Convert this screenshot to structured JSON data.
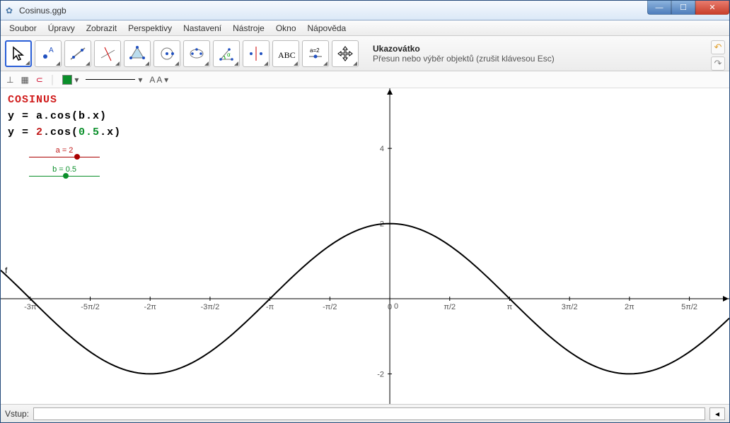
{
  "window": {
    "title": "Cosinus.ggb",
    "app_icon": "✿"
  },
  "winbuttons": {
    "min": "—",
    "max": "☐",
    "close": "✕"
  },
  "menu": [
    "Soubor",
    "Úpravy",
    "Zobrazit",
    "Perspektivy",
    "Nastavení",
    "Nástroje",
    "Okno",
    "Nápověda"
  ],
  "toolbar": {
    "selected_name": "Ukazovátko",
    "selected_desc": "Přesun nebo výběr objektů (zrušit klávesou Esc)",
    "back_icon": "↶",
    "fwd_icon": "↷"
  },
  "stylebar": {
    "axes": "⊥",
    "grid": "▦",
    "magnet": "⊂",
    "sep": "│",
    "fontsel": "A A ▾"
  },
  "overlay": {
    "title": "COSINUS",
    "eq_general": "y = a.cos(b.x)",
    "eq_specific_pre": "y = ",
    "eq_a": "2",
    "eq_mid": ".cos(",
    "eq_b": "0.5",
    "eq_post": ".x)"
  },
  "sliders": {
    "a": {
      "label": "a = 2",
      "pos": 0.68,
      "color": "red"
    },
    "b": {
      "label": "b = 0.5",
      "pos": 0.52,
      "color": "green"
    }
  },
  "inputbar": {
    "label": "Vstup:",
    "value": "",
    "drop": "◂"
  },
  "chart_data": {
    "type": "line",
    "title": "COSINUS",
    "function": "y = 2 * cos(0.5 * x)",
    "parameters": {
      "a": 2,
      "b": 0.5
    },
    "xlabel": "",
    "ylabel": "",
    "x_ticks_labels": [
      "-3π",
      "-5π/2",
      "-2π",
      "-3π/2",
      "-π",
      "-π/2",
      "0",
      "π/2",
      "π",
      "3π/2",
      "2π",
      "5π/2"
    ],
    "x_ticks_values": [
      -9.4248,
      -7.854,
      -6.2832,
      -4.7124,
      -3.1416,
      -1.5708,
      0,
      1.5708,
      3.1416,
      4.7124,
      6.2832,
      7.854
    ],
    "y_ticks": [
      -2,
      0,
      2,
      4
    ],
    "xlim": [
      -10.2,
      8.9
    ],
    "ylim": [
      -2.8,
      5.6
    ],
    "series": [
      {
        "name": "f",
        "x_from": -10.2,
        "x_to": 8.9,
        "step": 0.1,
        "formula": "2*cos(0.5*x)"
      }
    ],
    "object_label": "f"
  }
}
